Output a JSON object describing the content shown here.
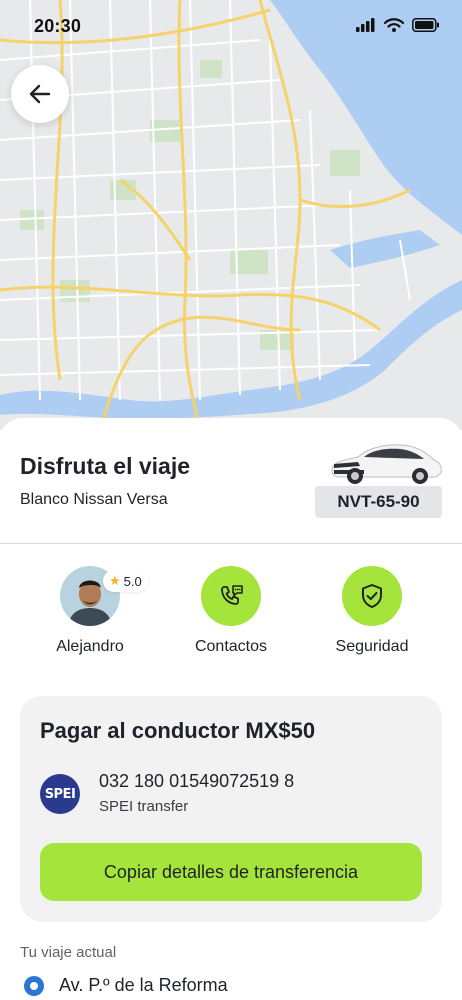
{
  "status_bar": {
    "time": "20:30"
  },
  "trip": {
    "title": "Disfruta el viaje",
    "car_description": "Blanco Nissan Versa",
    "plate": "NVT-65-90"
  },
  "driver": {
    "name": "Alejandro",
    "rating": "5.0"
  },
  "actions": {
    "contacts_label": "Contactos",
    "safety_label": "Seguridad"
  },
  "payment": {
    "title": "Pagar al conductor MX$50",
    "logo_text": "SPEI",
    "account_number": "032 180 01549072519 8",
    "account_type": "SPEI transfer",
    "copy_button_label": "Copiar detalles de transferencia"
  },
  "current_trip": {
    "label": "Tu viaje actual",
    "stop": "Av. P.º de la Reforma"
  },
  "colors": {
    "accent": "#a4e43b",
    "stop_dot": "#2a76d3",
    "spei_logo": "#2b3a8f"
  }
}
